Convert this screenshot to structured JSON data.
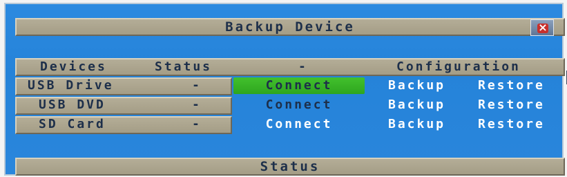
{
  "dialog": {
    "title": "Backup Device",
    "close_icon": "close-icon"
  },
  "table": {
    "headers": [
      "Devices",
      "Status",
      "-",
      "Configuration"
    ],
    "rows": [
      {
        "device": "USB Drive",
        "status": "-",
        "action": "Connect",
        "backup": "Backup",
        "restore": "Restore"
      },
      {
        "device": "USB DVD",
        "status": "-",
        "action": "Connect",
        "backup": "Backup",
        "restore": "Restore"
      },
      {
        "device": "SD Card",
        "status": "-",
        "action": "Connect",
        "backup": "Backup",
        "restore": "Restore"
      }
    ]
  },
  "status_bar": {
    "label": "Status"
  },
  "colors": {
    "panel_blue": "#2a86dc",
    "bar_tan": "#aca58f",
    "focus_green": "#38b426",
    "text_dark": "#1d2f4a"
  }
}
